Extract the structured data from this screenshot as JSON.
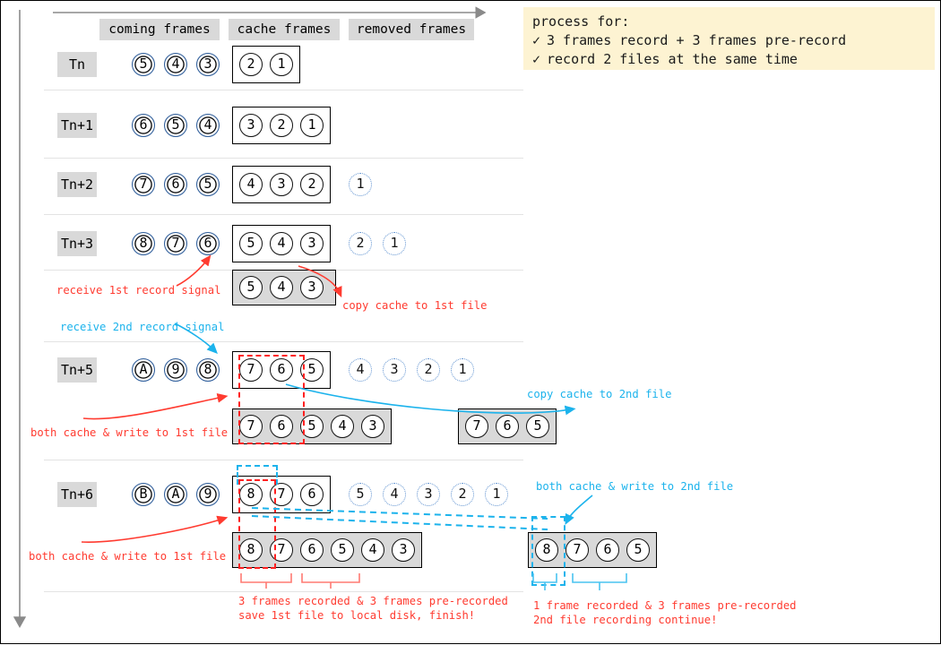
{
  "callout": {
    "title": "process for:",
    "check": "✓",
    "items": [
      "3 frames record + 3 frames pre-record",
      "record 2 files at the same time"
    ]
  },
  "headers": {
    "coming": "coming frames",
    "cache": "cache frames",
    "removed": "removed frames"
  },
  "colors": {
    "red": "#ff3b30",
    "cyan": "#1cb3ec",
    "coming_ring": "#2f5f9e",
    "box_fill": "#d9d9d9",
    "callout_bg": "#fdf3d2"
  },
  "rows": [
    {
      "time": "Tn",
      "coming": [
        "5",
        "4",
        "3"
      ],
      "cache": [
        "2",
        "1"
      ],
      "removed": []
    },
    {
      "time": "Tn+1",
      "coming": [
        "6",
        "5",
        "4"
      ],
      "cache": [
        "3",
        "2",
        "1"
      ],
      "removed": []
    },
    {
      "time": "Tn+2",
      "coming": [
        "7",
        "6",
        "5"
      ],
      "cache": [
        "4",
        "3",
        "2"
      ],
      "removed": [
        "1"
      ]
    },
    {
      "time": "Tn+3",
      "coming": [
        "8",
        "7",
        "6"
      ],
      "cache": [
        "5",
        "4",
        "3"
      ],
      "removed": [
        "2",
        "1"
      ]
    },
    {
      "time": "Tn+5",
      "coming": [
        "A",
        "9",
        "8"
      ],
      "cache": [
        "7",
        "6",
        "5"
      ],
      "removed": [
        "4",
        "3",
        "2",
        "1"
      ]
    },
    {
      "time": "Tn+6",
      "coming": [
        "B",
        "A",
        "9"
      ],
      "cache": [
        "8",
        "7",
        "6"
      ],
      "removed": [
        "5",
        "4",
        "3",
        "2",
        "1"
      ]
    }
  ],
  "files": {
    "tn3_first": [
      "5",
      "4",
      "3"
    ],
    "tn5_first": [
      "7",
      "6",
      "5",
      "4",
      "3"
    ],
    "tn5_second": [
      "7",
      "6",
      "5"
    ],
    "tn6_first": [
      "8",
      "7",
      "6",
      "5",
      "4",
      "3"
    ],
    "tn6_second": [
      "8",
      "7",
      "6",
      "5"
    ]
  },
  "notes": {
    "receive_1st": "receive 1st record signal",
    "receive_2nd": "receive 2nd record signal",
    "copy_1st": "copy cache to 1st file",
    "copy_2nd": "copy cache to 2nd file",
    "both_1st_tn5": "both cache & write to 1st file",
    "both_1st_tn6": "both cache & write to 1st file",
    "both_2nd_tn6": "both cache & write to 2nd file",
    "summary_left_line1": "3 frames recorded & 3 frames pre-recorded",
    "summary_left_line2": "save 1st file to local disk, finish!",
    "summary_right_line1": "1 frame recorded & 3 frames pre-recorded",
    "summary_right_line2": "2nd file recording continue!"
  }
}
